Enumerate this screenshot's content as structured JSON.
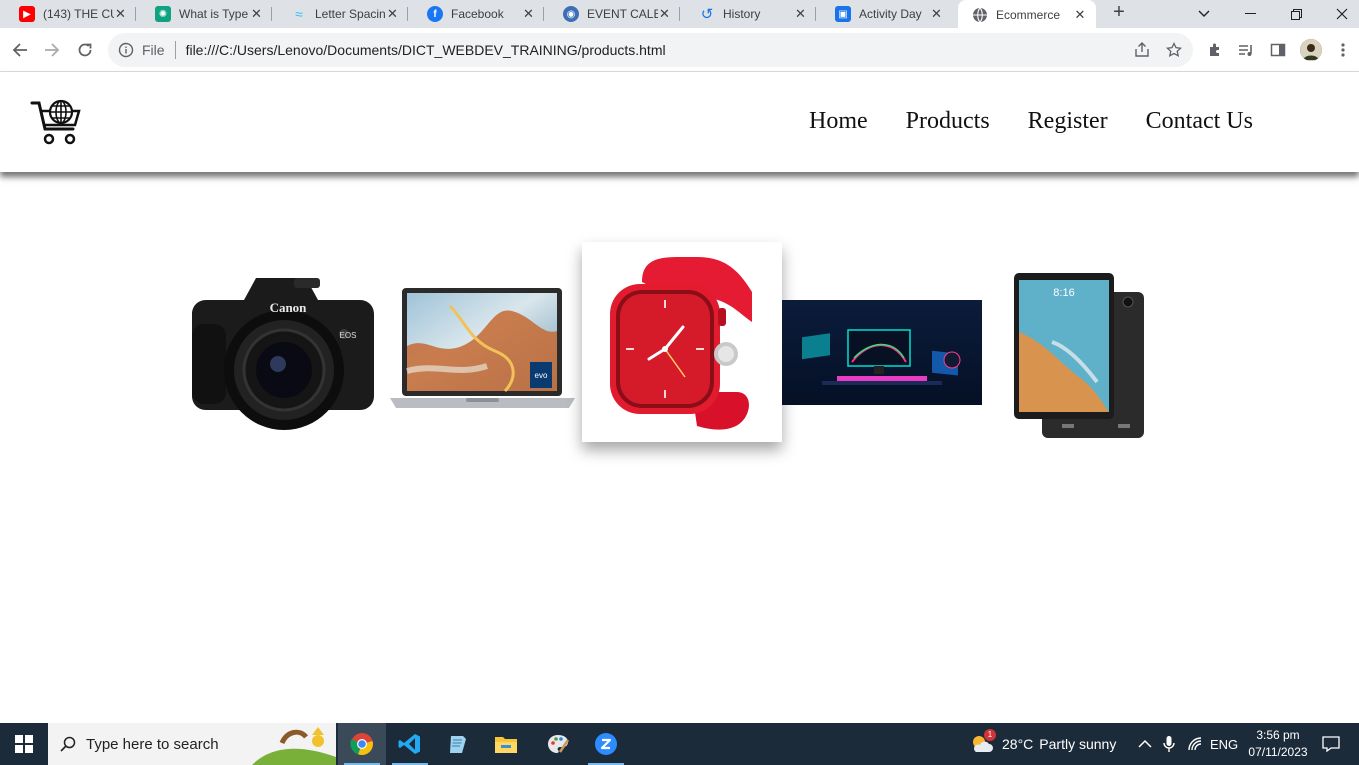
{
  "browser": {
    "tabs": [
      {
        "title": "(143) THE CU",
        "favicon": "youtube-icon",
        "color": "#ff0000"
      },
      {
        "title": "What is Type",
        "favicon": "chatgpt-icon",
        "color": "#10a37f"
      },
      {
        "title": "Letter Spacin",
        "favicon": "tailwind-icon",
        "color": "#38bdf8"
      },
      {
        "title": "Facebook",
        "favicon": "facebook-icon",
        "color": "#1877f2"
      },
      {
        "title": "EVENT CALE",
        "favicon": "event-icon",
        "color": "#3c6fb3"
      },
      {
        "title": "History",
        "favicon": "history-icon",
        "color": "#1a73e8"
      },
      {
        "title": "Activity Day",
        "favicon": "activity-icon",
        "color": "#1a73e8"
      },
      {
        "title": "Ecommerce",
        "favicon": "globe-icon",
        "color": "#5f6368",
        "active": true
      }
    ],
    "omnibox": {
      "scheme_label": "File",
      "url": "file:///C:/Users/Lenovo/Documents/DICT_WEBDEV_TRAINING/products.html"
    }
  },
  "site": {
    "nav": [
      {
        "label": "Home"
      },
      {
        "label": "Products"
      },
      {
        "label": "Register"
      },
      {
        "label": "Contact Us"
      }
    ],
    "products": [
      {
        "name": "camera",
        "brand_text": "Canon",
        "model_text": "EOS"
      },
      {
        "name": "laptop",
        "badge_text": "evo"
      },
      {
        "name": "smartwatch",
        "face_color": "#e8112d"
      },
      {
        "name": "gaming-setup"
      },
      {
        "name": "tablet",
        "screen_time": "8:16"
      }
    ]
  },
  "taskbar": {
    "search_placeholder": "Type here to search",
    "weather": {
      "temp": "28°C",
      "condition": "Partly sunny",
      "badge": "1"
    },
    "language": "ENG",
    "time": "3:56 pm",
    "date": "07/11/2023"
  }
}
